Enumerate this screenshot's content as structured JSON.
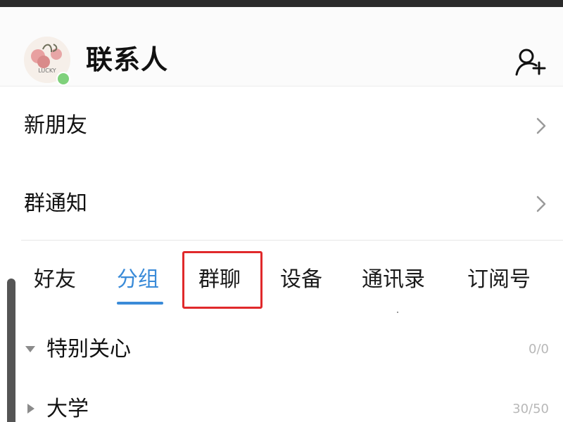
{
  "header": {
    "title": "联系人",
    "avatar_text": "LUCKY",
    "status_color": "#7fd17b"
  },
  "rows": [
    {
      "label": "新朋友",
      "icon": "chevron-right-icon"
    },
    {
      "label": "群通知",
      "icon": "chevron-right-icon"
    }
  ],
  "tabs": [
    {
      "label": "好友",
      "active": false
    },
    {
      "label": "分组",
      "active": true
    },
    {
      "label": "群聊",
      "active": false,
      "highlighted": true
    },
    {
      "label": "设备",
      "active": false
    },
    {
      "label": "通讯录",
      "active": false
    },
    {
      "label": "订阅号",
      "active": false
    }
  ],
  "groups": [
    {
      "label": "特别关心",
      "count": "0/0",
      "expanded": true
    },
    {
      "label": "大学",
      "count": "30/50",
      "expanded": false
    }
  ],
  "colors": {
    "accent": "#3a8bd8",
    "highlight": "#e0292b",
    "text": "#111111",
    "muted": "#b8b8b8"
  }
}
